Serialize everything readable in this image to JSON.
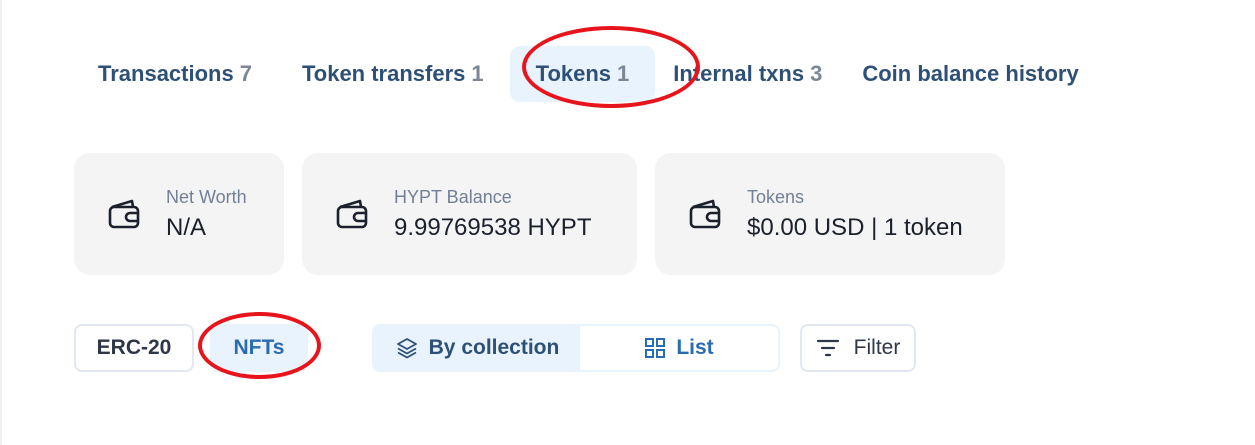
{
  "tabs": [
    {
      "label": "Transactions",
      "count": "7"
    },
    {
      "label": "Token transfers",
      "count": "1"
    },
    {
      "label": "Tokens",
      "count": "1"
    },
    {
      "label": "Internal txns",
      "count": "3"
    },
    {
      "label": "Coin balance history",
      "count": ""
    }
  ],
  "active_tab": "Tokens",
  "cards": [
    {
      "label": "Net Worth",
      "value": "N/A",
      "icon": "wallet-icon"
    },
    {
      "label": "HYPT Balance",
      "value": "9.99769538 HYPT",
      "icon": "wallet-icon"
    },
    {
      "label": "Tokens",
      "value": "$0.00 USD | 1 token",
      "icon": "wallet-icon"
    }
  ],
  "filters": {
    "erc20_label": "ERC-20",
    "nfts_label": "NFTs",
    "by_collection_label": "By collection",
    "list_label": "List",
    "filter_label": "Filter"
  },
  "colors": {
    "accent": "#2b6cb0",
    "tab_text": "#2e5077",
    "active_bg": "#e8f3fd",
    "card_bg": "#f4f4f5",
    "annotation": "#e8141c"
  }
}
